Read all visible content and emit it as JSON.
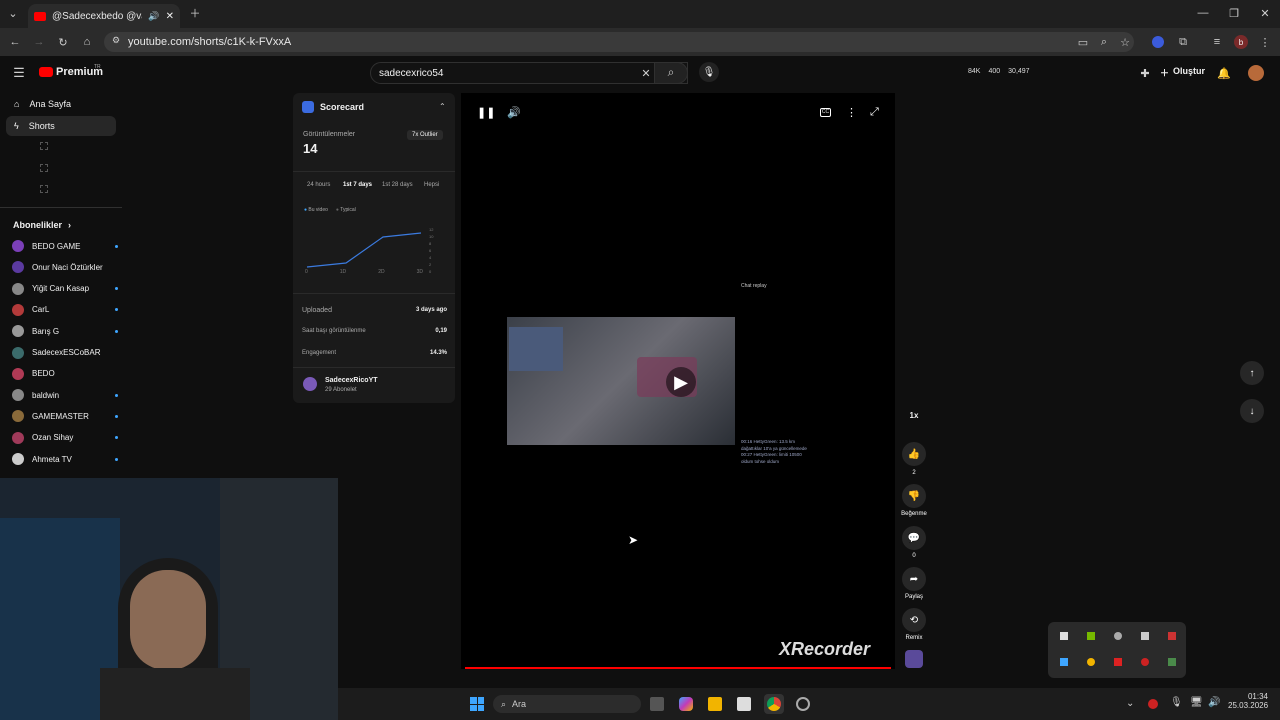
{
  "browser": {
    "tab_title": "@Sadecexbedo @valorant",
    "url": "youtube.com/shorts/c1K-k-FVxxA"
  },
  "youtube": {
    "brand": "Premium",
    "brand_region": "TR",
    "search_value": "sadecexrico54",
    "stats": {
      "a": "84K",
      "b": "400",
      "c": "30,497"
    },
    "create_label": "Oluştur"
  },
  "sidebar": {
    "items": [
      {
        "label": "Ana Sayfa",
        "icon": "home-icon"
      },
      {
        "label": "Shorts",
        "icon": "shorts-icon"
      }
    ],
    "subs_header": "Abonelikler",
    "subs": [
      {
        "name": "BEDO GAME",
        "color": "#7b3fb8",
        "dot": true
      },
      {
        "name": "Onur Naci Öztürkler",
        "color": "#5b3aa0",
        "dot": false
      },
      {
        "name": "Yiğit Can Kasap",
        "color": "#888888",
        "dot": true
      },
      {
        "name": "CarL",
        "color": "#b33a3a",
        "dot": true
      },
      {
        "name": "Barış G",
        "color": "#999999",
        "dot": true
      },
      {
        "name": "SadecexESCoBAR",
        "color": "#3b6b6b",
        "dot": false
      },
      {
        "name": "BEDO",
        "color": "#b03a55",
        "dot": false
      },
      {
        "name": "baldwin",
        "color": "#888888",
        "dot": true
      },
      {
        "name": "GAMEMASTER",
        "color": "#8a6a3a",
        "dot": true
      },
      {
        "name": "Ozan Sihay",
        "color": "#a03a5a",
        "dot": true
      },
      {
        "name": "Ahmeta TV",
        "color": "#cccccc",
        "dot": true
      }
    ]
  },
  "scorecard": {
    "title": "Scorecard",
    "views_label": "Görüntülenmeler",
    "views_value": "14",
    "outlier": "7x Outlier",
    "ranges": [
      "24 hours",
      "1st 7 days",
      "1st 28 days",
      "Hepsi"
    ],
    "legend": [
      "Bu video",
      "Typical"
    ],
    "xticks": [
      "0",
      "1D",
      "2D",
      "3D"
    ],
    "yticks": [
      "12",
      "10",
      "8",
      "6",
      "4",
      "2",
      "0"
    ],
    "uploaded_label": "Uploaded",
    "uploaded_value": "3 days ago",
    "hourly_label": "Saat başı görüntülenme",
    "hourly_value": "0,19",
    "engagement_label": "Engagement",
    "engagement_value": "14.3%",
    "channel_name": "SadecexRicoYT",
    "channel_subs": "29 Abonelet"
  },
  "video": {
    "chat_replay": "Chat replay",
    "watermark": "XRecorder",
    "chat_lines": [
      "00:16 HettyGreen: 13.5 km",
      "dağattıklar 10'a ya güncellemede",
      "00:27 HettyGreen: limiti 10500",
      "oldum tohse oldum"
    ]
  },
  "actions": {
    "speed": "1x",
    "like_count": "2",
    "dislike_label": "Beğenme",
    "comments": "0",
    "share": "Paylaş",
    "remix": "Remix"
  },
  "taskbar": {
    "search_placeholder": "Ara",
    "time": "01:34",
    "date": "25.03.2026"
  }
}
